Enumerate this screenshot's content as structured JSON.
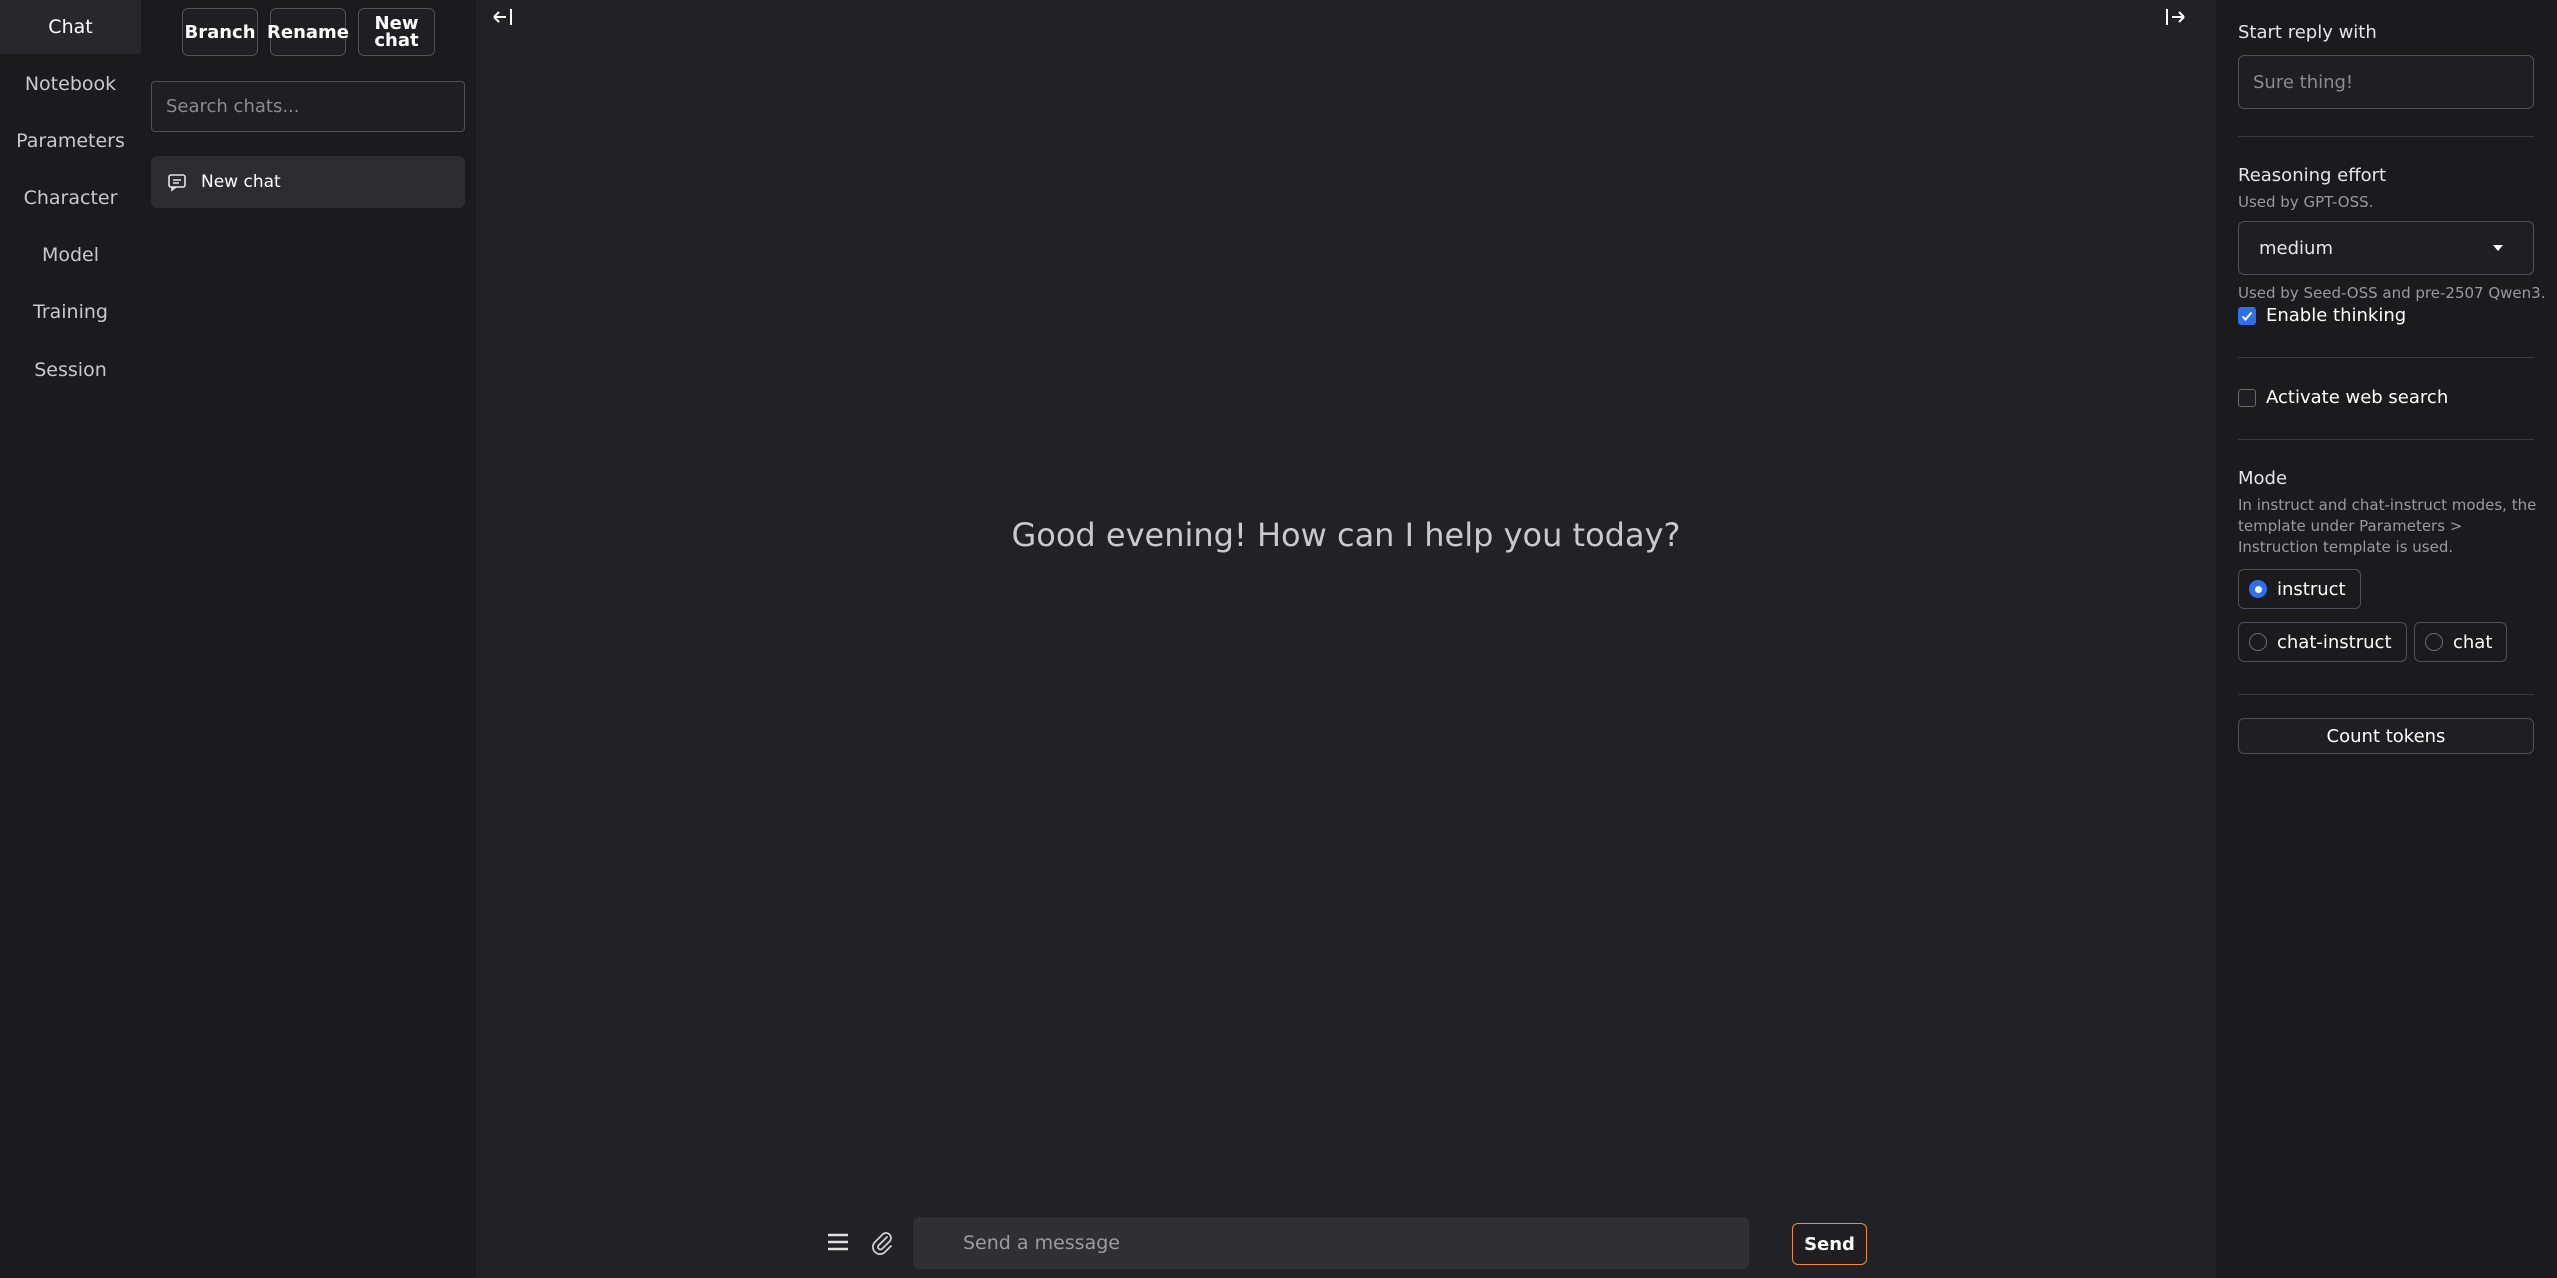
{
  "nav": {
    "close_icon": "close-icon",
    "items": [
      {
        "label": "Chat",
        "active": true
      },
      {
        "label": "Notebook"
      },
      {
        "label": "Parameters"
      },
      {
        "label": "Character"
      },
      {
        "label": "Model"
      },
      {
        "label": "Training"
      },
      {
        "label": "Session"
      }
    ]
  },
  "chatlist": {
    "branch_label": "Branch",
    "rename_label": "Rename",
    "new_chat_label_1": "New",
    "new_chat_label_2": "chat",
    "search_placeholder": "Search chats...",
    "entries": [
      {
        "label": "New chat",
        "icon": "chat-bubble-icon"
      }
    ]
  },
  "main": {
    "collapse_left_icon": "collapse-left-icon",
    "expand_right_icon": "expand-right-icon",
    "greeting": "Good evening! How can I help you today?",
    "menu_icon": "hamburger-menu-icon",
    "attach_icon": "paperclip-icon",
    "message_placeholder": "Send a message",
    "send_label": "Send",
    "send_border_color": "#f08c3c"
  },
  "panel": {
    "start_reply_label": "Start reply with",
    "start_reply_placeholder": "Sure thing!",
    "reasoning_label": "Reasoning effort",
    "reasoning_sub": "Used by GPT-OSS.",
    "reasoning_value": "medium",
    "thinking_note": "Used by Seed-OSS and pre-2507 Qwen3.",
    "enable_thinking_label": "Enable thinking",
    "enable_thinking_checked": true,
    "web_search_label": "Activate web search",
    "web_search_checked": false,
    "mode_label": "Mode",
    "mode_desc": "In instruct and chat-instruct modes, the template under Parameters > Instruction template is used.",
    "modes": [
      {
        "label": "instruct",
        "selected": true
      },
      {
        "label": "chat-instruct",
        "selected": false
      },
      {
        "label": "chat",
        "selected": false
      }
    ],
    "count_tokens_label": "Count tokens",
    "accent_color": "#2f6fea"
  }
}
